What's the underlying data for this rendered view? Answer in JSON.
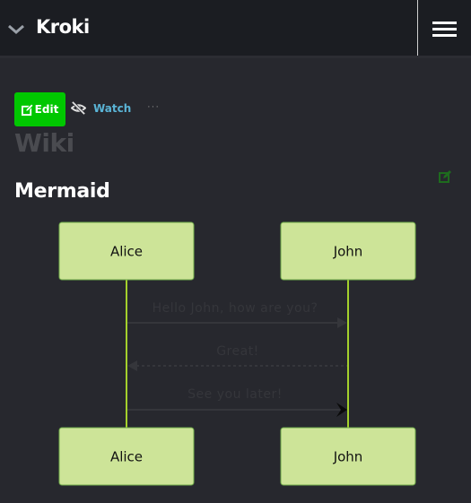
{
  "header": {
    "title": "Kroki",
    "collapse_icon": "chevron-down-icon",
    "menu_icon": "hamburger-menu-icon"
  },
  "toolbar": {
    "edit_label": "Edit",
    "edit_icon": "edit-icon",
    "watch_label": "Watch",
    "watch_icon": "eye-slash-icon",
    "more_label": "···"
  },
  "page": {
    "title": "Wiki",
    "section_title": "Mermaid",
    "section_edit_icon": "edit-icon"
  },
  "diagram": {
    "type": "sequence",
    "actors": [
      {
        "name": "Alice"
      },
      {
        "name": "John"
      }
    ],
    "messages": [
      {
        "from": "Alice",
        "to": "John",
        "text": "Hello John, how are you?",
        "style": "solid",
        "arrow": "filled"
      },
      {
        "from": "John",
        "to": "Alice",
        "text": "Great!",
        "style": "dotted",
        "arrow": "filled"
      },
      {
        "from": "Alice",
        "to": "John",
        "text": "See you later!",
        "style": "solid",
        "arrow": "open"
      }
    ],
    "colors": {
      "actor_fill": "#cde498",
      "actor_stroke": "#6eaa49",
      "lifeline": "#a4d12c",
      "message": "#35363b"
    }
  },
  "colors": {
    "background": "#27282e",
    "header": "#1b1d22",
    "edit_button": "#00c700",
    "watch_link": "#5ab4d6",
    "section_edit_icon": "#1e6b1e"
  }
}
